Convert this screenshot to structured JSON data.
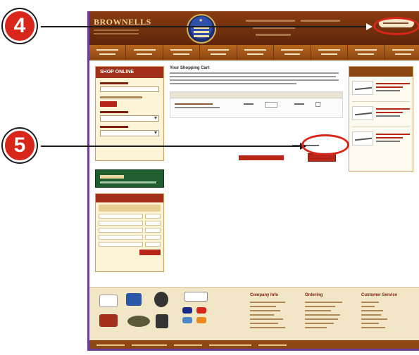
{
  "callouts": {
    "step4": "4",
    "step5": "5"
  },
  "site": {
    "logo_text": "BROWNELLS"
  },
  "cart": {
    "title": "Your Shopping Cart"
  },
  "left": {
    "shop_online_title": "SHOP ONLINE"
  },
  "footer": {
    "col1_title": "Company Info",
    "col2_title": "Ordering",
    "col3_title": "Customer Service"
  },
  "colors": {
    "callout": "#d8261a",
    "header": "#8a3c12",
    "accent_red": "#b8261a"
  }
}
